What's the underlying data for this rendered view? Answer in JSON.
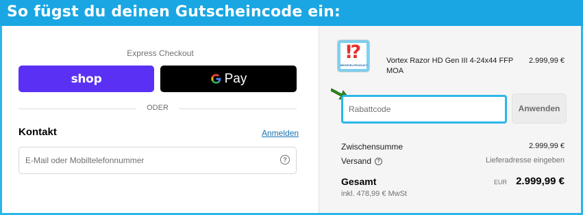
{
  "banner": {
    "title": "So fügst du deinen Gutscheincode ein:"
  },
  "checkout": {
    "express_label": "Express Checkout",
    "shop_label": "shop",
    "gpay_label": "Pay",
    "gpay_g": "G",
    "separator": "ODER",
    "contact_heading": "Kontakt",
    "login_link": "Anmelden",
    "email_placeholder": "E-Mail oder Mobiltelefonnummer",
    "help_icon_glyph": "?"
  },
  "order": {
    "product": {
      "name": "Vortex Razor HD Gen III 4-24x44 FFP MOA",
      "price": "2.999,99 €",
      "thumb_glyph": "⁉",
      "thumb_caption": "BEISPIELPRODUKT"
    },
    "discount_placeholder": "Rabattcode",
    "apply_label": "Anwenden",
    "subtotal_label": "Zwischensumme",
    "subtotal_value": "2.999,99 €",
    "shipping_label": "Versand",
    "shipping_help_glyph": "?",
    "shipping_value": "Lieferadresse eingeben",
    "total_label": "Gesamt",
    "currency": "EUR",
    "total_value": "2.999,99 €",
    "tax_note": "inkl. 478,99 € MwSt"
  },
  "colors": {
    "banner": "#1aa6e2",
    "shop_purple": "#5a31f4",
    "highlight": "#29b6e8",
    "arrow_green": "#2e8b22",
    "link_blue": "#1773b0"
  },
  "icons": [
    "help-icon",
    "google-g-icon",
    "green-arrow-icon",
    "product-thumbnail"
  ]
}
